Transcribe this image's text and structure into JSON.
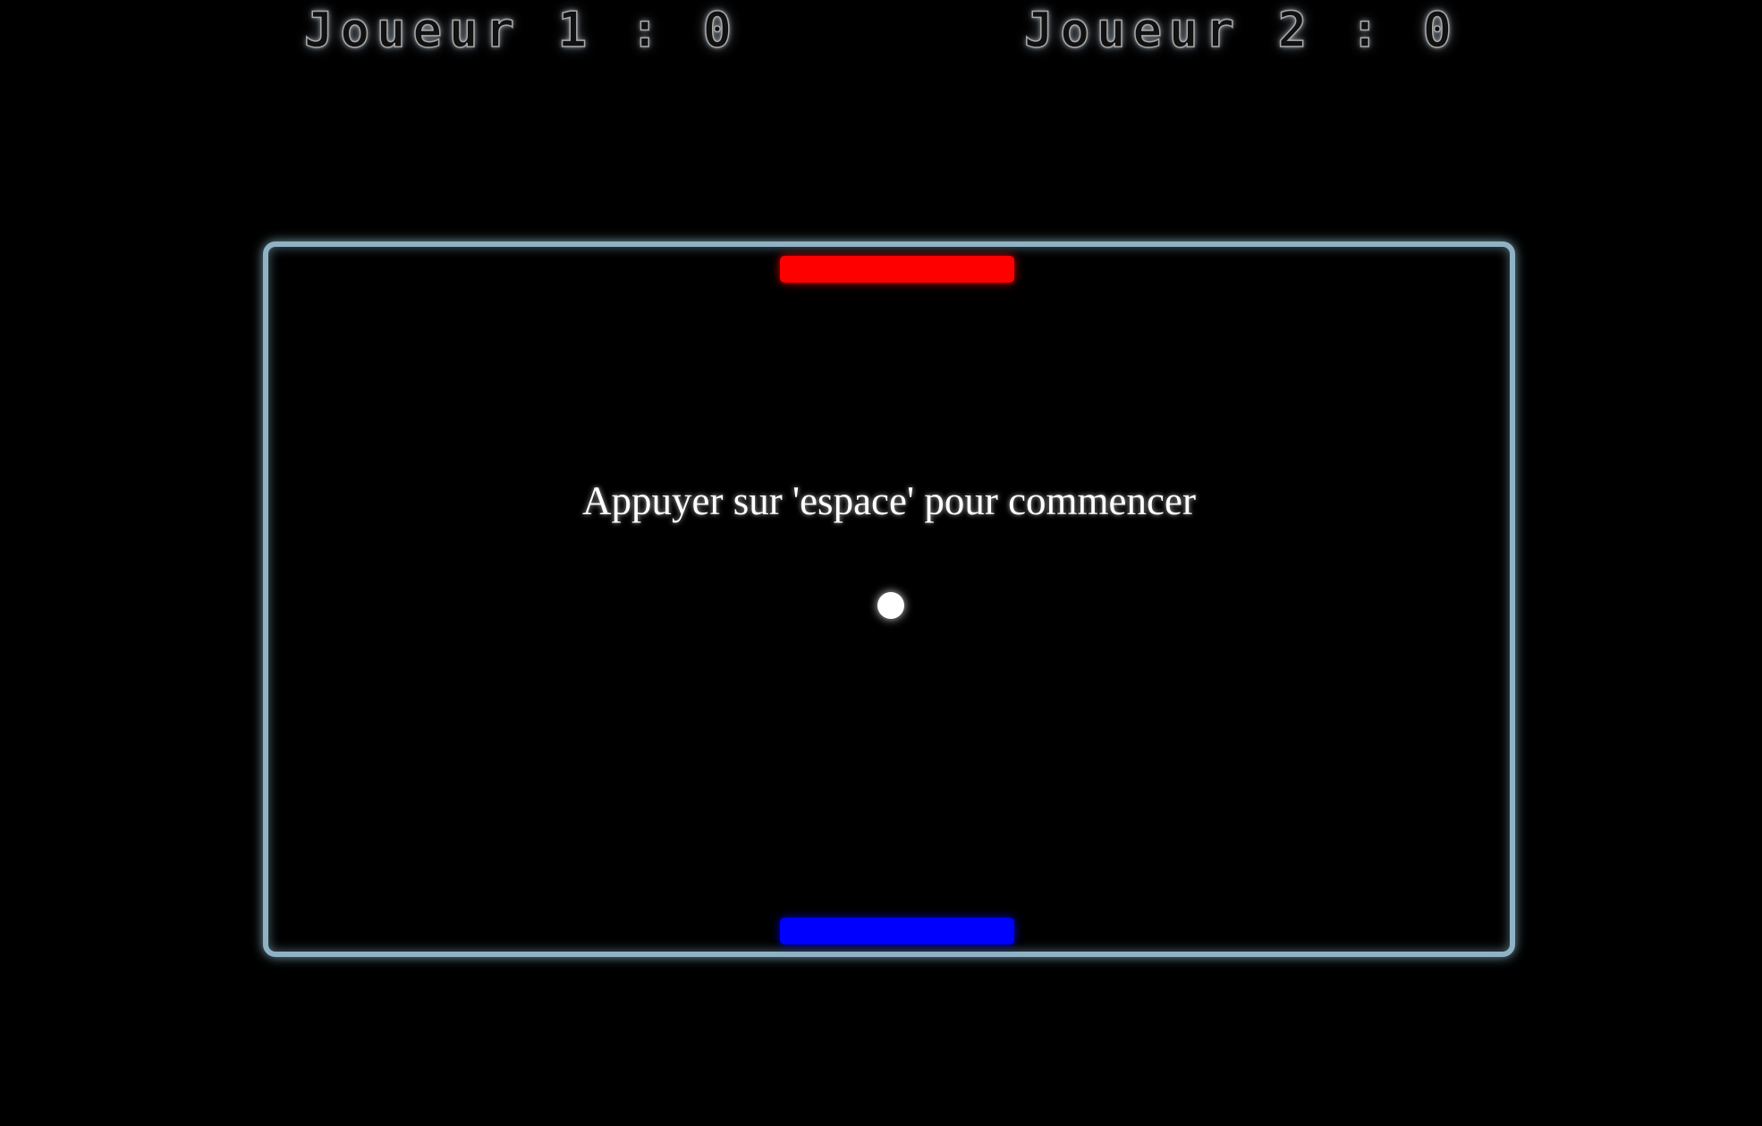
{
  "scoreboard": {
    "player1": {
      "label": "Joueur 1",
      "separator": ":",
      "score": "0"
    },
    "player2": {
      "label": "Joueur 2",
      "separator": ":",
      "score": "0"
    }
  },
  "arena": {
    "prompt": "Appuyer sur 'espace' pour commencer",
    "border_color": "#8fb3c4"
  },
  "paddles": {
    "top_color": "#ff0000",
    "bottom_color": "#0000ff"
  },
  "ball": {
    "color": "#ffffff"
  }
}
